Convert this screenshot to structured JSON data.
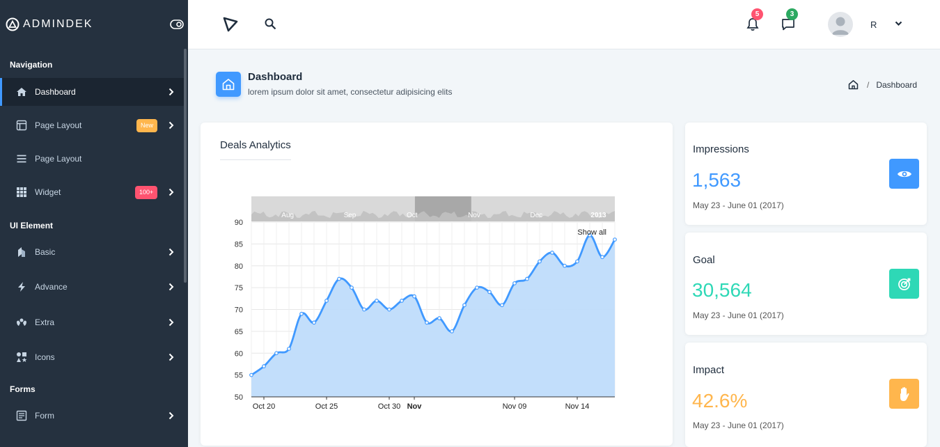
{
  "brand": {
    "name": "ADMINDEK"
  },
  "sidebar": {
    "sections": [
      "Navigation",
      "UI Element",
      "Forms"
    ],
    "items": [
      {
        "label": "Dashboard",
        "icon": "home-icon"
      },
      {
        "label": "Page Layout",
        "icon": "layout-icon",
        "badge": "New"
      },
      {
        "label": "Page Layout",
        "icon": "menu-icon"
      },
      {
        "label": "Widget",
        "icon": "grid-icon",
        "badge": "100+"
      },
      {
        "label": "Basic",
        "icon": "layers-icon"
      },
      {
        "label": "Advance",
        "icon": "bolt-icon"
      },
      {
        "label": "Extra",
        "icon": "extra-icon"
      },
      {
        "label": "Icons",
        "icon": "shapes-icon"
      },
      {
        "label": "Form",
        "icon": "form-icon"
      }
    ]
  },
  "topbar": {
    "notifications_count": "5",
    "messages_count": "3",
    "user_initial": "R"
  },
  "page_header": {
    "title": "Dashboard",
    "subtitle": "lorem ipsum dolor sit amet, consectetur adipisicing elits",
    "breadcrumb": "Dashboard"
  },
  "deals": {
    "title": "Deals Analytics",
    "show_all": "Show all"
  },
  "chart_data": {
    "type": "area",
    "x": [
      "Oct 19",
      "Oct 20",
      "Oct 21",
      "Oct 22",
      "Oct 23",
      "Oct 24",
      "Oct 25",
      "Oct 26",
      "Oct 27",
      "Oct 28",
      "Oct 29",
      "Oct 30",
      "Oct 31",
      "Nov 01",
      "Nov 02",
      "Nov 03",
      "Nov 04",
      "Nov 05",
      "Nov 06",
      "Nov 07",
      "Nov 08",
      "Nov 09",
      "Nov 10",
      "Nov 11",
      "Nov 12",
      "Nov 13",
      "Nov 14",
      "Nov 15",
      "Nov 16",
      "Nov 17"
    ],
    "values": [
      55,
      57,
      60,
      61,
      69,
      67,
      72,
      77,
      75,
      70,
      72,
      70,
      72,
      73,
      67,
      68,
      65,
      71,
      75,
      74,
      71,
      76,
      77,
      81,
      83,
      80,
      81,
      87,
      82,
      86
    ],
    "x_tick_labels": [
      "Oct 20",
      "Oct 25",
      "Oct 30",
      "Nov",
      "Nov 09",
      "Nov 14"
    ],
    "y_ticks": [
      50,
      55,
      60,
      65,
      70,
      75,
      80,
      85,
      90
    ],
    "ylim": [
      50,
      90
    ],
    "navigator_labels": [
      "Aug",
      "Sep",
      "Oct",
      "Nov",
      "Dec",
      "2013"
    ],
    "grid": true,
    "color": "#4099ff"
  },
  "stats": [
    {
      "title": "Impressions",
      "value": "1,563",
      "date": "May 23 - June 01 (2017)",
      "color": "#4099ff",
      "icon": "eye-icon"
    },
    {
      "title": "Goal",
      "value": "30,564",
      "date": "May 23 - June 01 (2017)",
      "color": "#2ed8b6",
      "icon": "target-icon"
    },
    {
      "title": "Impact",
      "value": "42.6%",
      "date": "May 23 - June 01 (2017)",
      "color": "#ffb64d",
      "icon": "hand-icon"
    }
  ]
}
